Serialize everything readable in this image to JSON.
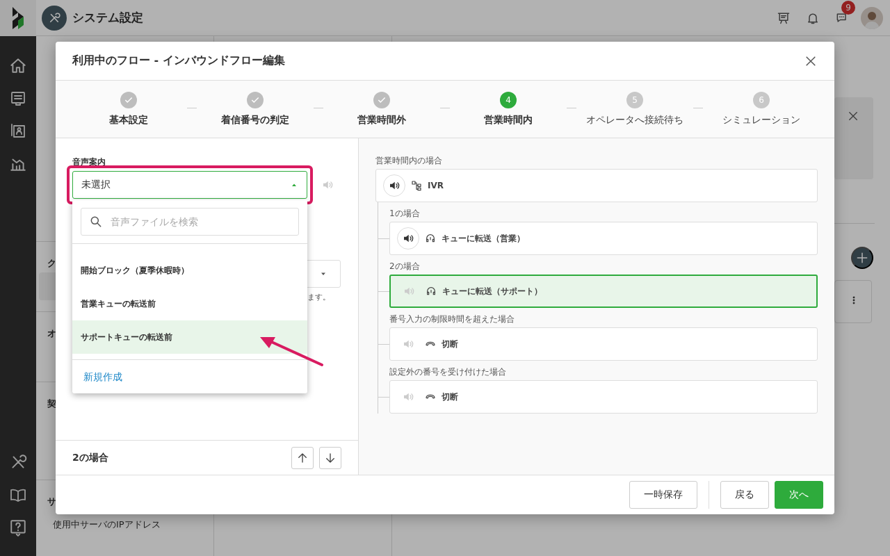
{
  "app": {
    "title": "システム設定",
    "badge": "9"
  },
  "sidebar": {
    "sections": [
      {
        "heading": "ク"
      },
      {
        "heading": "オ"
      },
      {
        "heading": "契"
      },
      {
        "heading": "サ",
        "items": [
          {
            "label": "使用中サーバのIPアドレス"
          }
        ]
      }
    ]
  },
  "modal": {
    "title": "利用中のフロー - インバウンドフロー編集",
    "steps": [
      {
        "label": "基本設定",
        "done": true,
        "current": false
      },
      {
        "label": "着信番号の判定",
        "done": true,
        "current": false
      },
      {
        "label": "営業時間外",
        "done": true,
        "current": false
      },
      {
        "number": "4",
        "label": "営業時間内",
        "done": false,
        "current": true
      },
      {
        "number": "5",
        "label": "オペレータへ接続待ち",
        "done": false,
        "current": false
      },
      {
        "number": "6",
        "label": "シミュレーション",
        "done": false,
        "current": false
      }
    ],
    "form": {
      "label": "音声案内",
      "select": {
        "value": "未選択",
        "expanded": true
      },
      "search": {
        "placeholder": "音声ファイルを検索"
      },
      "options": [
        {
          "label": "開始ブロック（夏季休暇時）",
          "selected": false
        },
        {
          "label": "営業キューの転送前",
          "selected": false
        },
        {
          "label": "サポートキューの転送前",
          "selected": true
        }
      ],
      "create_link": "新規作成",
      "note": "ます。",
      "section": "2の場合"
    },
    "flow": {
      "heading": "営業時間内の場合",
      "root": {
        "kind": "ivr",
        "label": "IVR",
        "audio": true,
        "selected": false
      },
      "branches": [
        {
          "condition": "1の場合",
          "node": {
            "kind": "queue",
            "label": "キューに転送（営業）",
            "audio": true,
            "selected": false
          }
        },
        {
          "condition": "2の場合",
          "node": {
            "kind": "queue",
            "label": "キューに転送（サポート）",
            "audio": false,
            "selected": true
          }
        },
        {
          "condition": "番号入力の制限時間を超えた場合",
          "node": {
            "kind": "hangup",
            "label": "切断",
            "audio": false,
            "selected": false
          }
        },
        {
          "condition": "設定外の番号を受け付けた場合",
          "node": {
            "kind": "hangup",
            "label": "切断",
            "audio": false,
            "selected": false
          }
        }
      ]
    },
    "buttons": [
      {
        "label": "一時保存",
        "kind": "secondary"
      },
      {
        "label": "戻る",
        "kind": "secondary"
      },
      {
        "label": "次へ",
        "kind": "primary"
      }
    ]
  }
}
